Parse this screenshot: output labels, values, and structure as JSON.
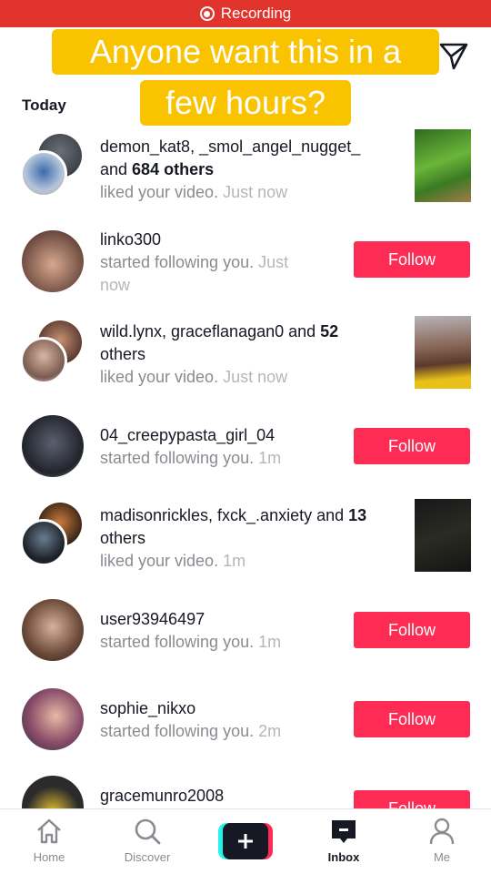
{
  "status_bar": {
    "recording_label": "Recording"
  },
  "caption": {
    "line1": "Anyone want this in a",
    "line2": "few hours?"
  },
  "section": {
    "title": "Today"
  },
  "notifications": [
    {
      "names": "demon_kat8, _smol_angel_nugget_",
      "names2": "and ",
      "count_bold": "684 others",
      "desc": "liked your video.",
      "time": "Just now"
    },
    {
      "names": "linko300",
      "desc": "started following you.",
      "time": "Just",
      "time2": "now",
      "button": "Follow"
    },
    {
      "names": "wild.lynx, graceflanagan0",
      "mid": " and ",
      "count_bold": "52",
      "names2": "others",
      "desc": "liked your video.",
      "time": "Just now"
    },
    {
      "names": "04_creepypasta_girl_04",
      "desc": "started following you.",
      "time": "1m",
      "button": "Follow"
    },
    {
      "names": "madisonrickles, fxck_.anxiety",
      "mid": " and ",
      "count_bold": "13",
      "names2": "others",
      "desc": "liked your video.",
      "time": "1m"
    },
    {
      "names": "user93946497",
      "desc": "started following you.",
      "time": "1m",
      "button": "Follow"
    },
    {
      "names": "sophie_nikxo",
      "desc": "started following you.",
      "time": "2m",
      "button": "Follow"
    },
    {
      "names": "gracemunro2008",
      "button": "Follow"
    }
  ],
  "nav": {
    "home": "Home",
    "discover": "Discover",
    "inbox": "Inbox",
    "me": "Me"
  },
  "colors": {
    "accent": "#fe2c55",
    "recording": "#e0342c",
    "caption_bg": "#f9c300"
  }
}
